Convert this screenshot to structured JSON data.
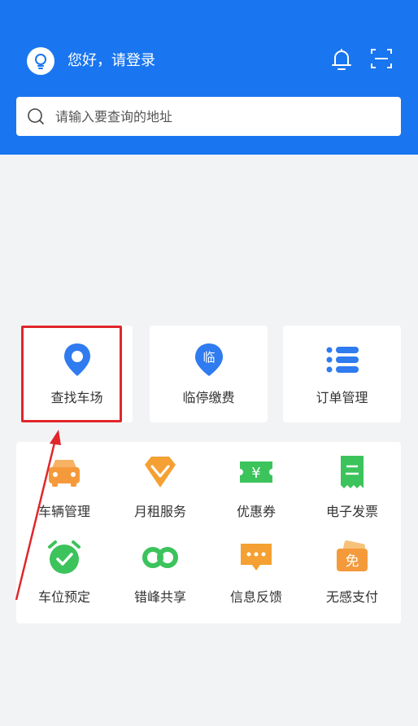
{
  "header": {
    "greeting": "您好，请登录",
    "search_placeholder": "请输入要查询的地址"
  },
  "quick_actions": [
    {
      "label": "查找车场",
      "icon": "location-pin-icon",
      "color": "#2f7bf0"
    },
    {
      "label": "临停缴费",
      "icon": "temporary-parking-pin-icon",
      "icon_text": "临",
      "color": "#2f7bf0"
    },
    {
      "label": "订单管理",
      "icon": "list-icon",
      "color": "#2f7bf0"
    }
  ],
  "services": [
    {
      "label": "车辆管理",
      "icon": "car-icon",
      "color": "#f59a3b"
    },
    {
      "label": "月租服务",
      "icon": "diamond-icon",
      "color": "#f5a032"
    },
    {
      "label": "优惠券",
      "icon": "coupon-icon",
      "icon_text": "¥",
      "color": "#3cc35c"
    },
    {
      "label": "电子发票",
      "icon": "invoice-icon",
      "color": "#3cc35c"
    },
    {
      "label": "车位预定",
      "icon": "alarm-clock-icon",
      "color": "#3cc35c"
    },
    {
      "label": "错峰共享",
      "icon": "infinity-icon",
      "color": "#3cc35c"
    },
    {
      "label": "信息反馈",
      "icon": "chat-bubble-icon",
      "color": "#f5a032"
    },
    {
      "label": "无感支付",
      "icon": "free-pass-icon",
      "icon_text": "免",
      "color": "#f59a3b"
    }
  ],
  "colors": {
    "header_bg": "#1976f0",
    "page_bg": "#f2f3f5",
    "highlight": "#e0262a"
  }
}
